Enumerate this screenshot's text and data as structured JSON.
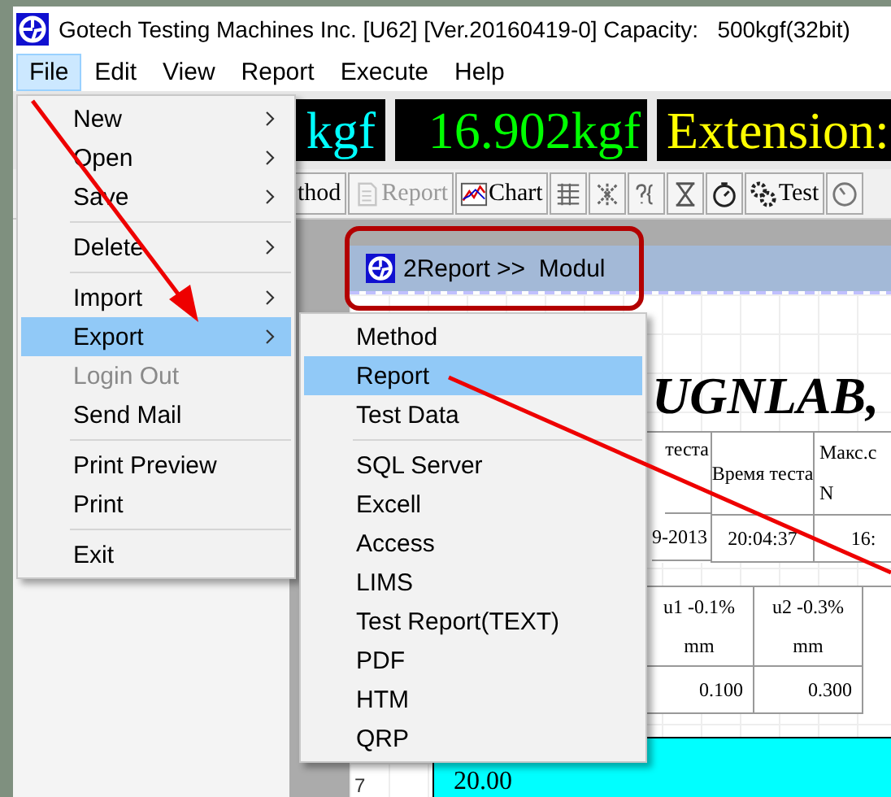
{
  "window": {
    "title": "Gotech Testing Machines Inc. [U62] [Ver.20160419-0] Capacity:   500kgf(32bit)"
  },
  "menu_bar": [
    {
      "label": "File",
      "selected": true
    },
    {
      "label": "Edit",
      "selected": false
    },
    {
      "label": "View",
      "selected": false
    },
    {
      "label": "Report",
      "selected": false
    },
    {
      "label": "Execute",
      "selected": false
    },
    {
      "label": "Help",
      "selected": false
    }
  ],
  "readouts": [
    {
      "text": "kgf"
    },
    {
      "text": "16.902kgf"
    },
    {
      "text": "Extension:"
    }
  ],
  "toolbar": [
    {
      "kind": "text",
      "label": "thod",
      "disabled": false
    },
    {
      "kind": "report",
      "label": "Report",
      "disabled": true
    },
    {
      "kind": "chart",
      "label": "Chart",
      "disabled": false
    },
    {
      "kind": "table",
      "disabled": false
    },
    {
      "kind": "tools",
      "disabled": false
    },
    {
      "kind": "help",
      "disabled": false
    },
    {
      "kind": "hourglass",
      "disabled": false
    },
    {
      "kind": "stopwatch",
      "disabled": false
    },
    {
      "kind": "test",
      "label": "Test",
      "disabled": false
    },
    {
      "kind": "clock",
      "disabled": false
    }
  ],
  "child_window": {
    "title": "2Report >>  Modul",
    "highlighted": true
  },
  "report": {
    "heading": "UGNLAB,",
    "table_1": [
      {
        "header": [
          "теста"
        ],
        "value": "9-2013"
      },
      {
        "header": [
          "Время теста"
        ],
        "value": "20:04:37"
      },
      {
        "header": [
          "Макс.с",
          "N"
        ],
        "value": "16:"
      }
    ],
    "table_2": [
      {
        "header": [
          "u1 -0.1%",
          "mm"
        ],
        "value": "0.100"
      },
      {
        "header": [
          "u2 -0.3%",
          "mm"
        ],
        "value": "0.300"
      }
    ],
    "row_number": "7",
    "chart_label": "20.00"
  },
  "file_menu": [
    {
      "kind": "item",
      "label": "New",
      "submenu": true,
      "selected": false,
      "disabled": false
    },
    {
      "kind": "item",
      "label": "Open",
      "submenu": true,
      "selected": false,
      "disabled": false
    },
    {
      "kind": "item",
      "label": "Save",
      "submenu": true,
      "selected": false,
      "disabled": false
    },
    {
      "kind": "separator"
    },
    {
      "kind": "item",
      "label": "Delete",
      "submenu": true,
      "selected": false,
      "disabled": false
    },
    {
      "kind": "separator"
    },
    {
      "kind": "item",
      "label": "Import",
      "submenu": true,
      "selected": false,
      "disabled": false
    },
    {
      "kind": "item",
      "label": "Export",
      "submenu": true,
      "selected": true,
      "disabled": false
    },
    {
      "kind": "item",
      "label": "Login Out",
      "submenu": false,
      "selected": false,
      "disabled": true
    },
    {
      "kind": "item",
      "label": "Send Mail",
      "submenu": false,
      "selected": false,
      "disabled": false
    },
    {
      "kind": "separator"
    },
    {
      "kind": "item",
      "label": "Print Preview",
      "submenu": false,
      "selected": false,
      "disabled": false
    },
    {
      "kind": "item",
      "label": "Print",
      "submenu": false,
      "selected": false,
      "disabled": false
    },
    {
      "kind": "separator"
    },
    {
      "kind": "item",
      "label": "Exit",
      "submenu": false,
      "selected": false,
      "disabled": false
    }
  ],
  "export_menu": [
    {
      "kind": "item",
      "label": "Method",
      "selected": false
    },
    {
      "kind": "item",
      "label": "Report",
      "selected": true
    },
    {
      "kind": "item",
      "label": "Test Data",
      "selected": false
    },
    {
      "kind": "separator"
    },
    {
      "kind": "item",
      "label": "SQL Server",
      "selected": false
    },
    {
      "kind": "item",
      "label": "Excell",
      "selected": false
    },
    {
      "kind": "item",
      "label": "Access",
      "selected": false
    },
    {
      "kind": "item",
      "label": "LIMS",
      "selected": false
    },
    {
      "kind": "item",
      "label": "Test Report(TEXT)",
      "selected": false
    },
    {
      "kind": "item",
      "label": "PDF",
      "selected": false
    },
    {
      "kind": "item",
      "label": "HTM",
      "selected": false
    },
    {
      "kind": "item",
      "label": "QRP",
      "selected": false
    }
  ]
}
